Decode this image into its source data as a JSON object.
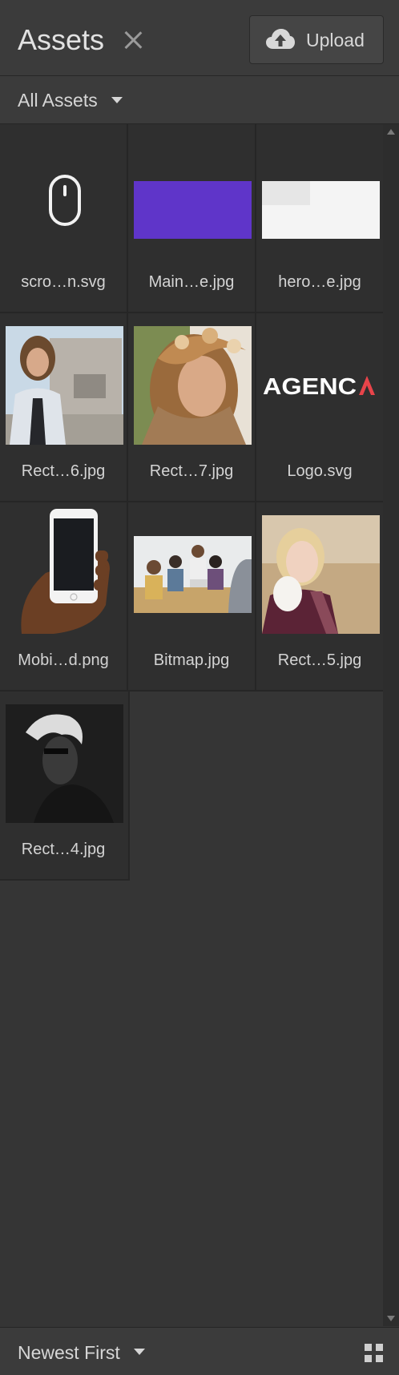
{
  "header": {
    "title": "Assets",
    "upload_label": "Upload"
  },
  "filter": {
    "selected": "All Assets"
  },
  "assets": [
    {
      "name": "scro…n.svg",
      "kind": "mouse-icon"
    },
    {
      "name": "Main…e.jpg",
      "kind": "purple-banner"
    },
    {
      "name": "hero…e.jpg",
      "kind": "white-banner"
    },
    {
      "name": "Rect…6.jpg",
      "kind": "photo-man-concrete"
    },
    {
      "name": "Rect…7.jpg",
      "kind": "photo-woman-flowers"
    },
    {
      "name": "Logo.svg",
      "kind": "agency-logo",
      "logo_text": "AGENCY"
    },
    {
      "name": "Mobi…d.png",
      "kind": "phone-in-hand"
    },
    {
      "name": "Bitmap.jpg",
      "kind": "photo-meeting"
    },
    {
      "name": "Rect…5.jpg",
      "kind": "photo-blonde-woman"
    },
    {
      "name": "Rect…4.jpg",
      "kind": "photo-dark-portrait"
    }
  ],
  "footer": {
    "sort_selected": "Newest First"
  },
  "colors": {
    "background": "#353535",
    "panel": "#3b3b3b",
    "tile": "#2f2f2f",
    "accent_purple": "#5b32c4",
    "logo_red": "#e8444a"
  }
}
